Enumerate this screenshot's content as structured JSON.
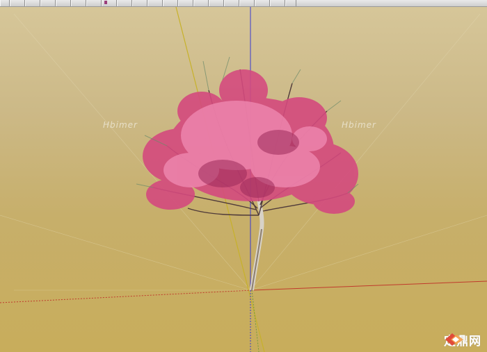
{
  "app": {
    "watermarks": [
      "Hbimer",
      "Hbimer"
    ],
    "brand_logo": {
      "icon": "diamond-logo-icon",
      "text": "定鼎网"
    }
  },
  "toolbar": {
    "icons": [
      "toolbar-icon"
    ],
    "colors": {
      "background": "#dcdcdc",
      "border": "#8f8f8f"
    }
  },
  "viewport": {
    "model": "blossom-tree",
    "axes": {
      "red_axis_color": "#c0392b",
      "green_axis_color": "#6e9a3c",
      "blue_axis_color": "#3a3ad0",
      "guide_color": "#c7b12a"
    },
    "background_colors": [
      "#d6c699",
      "#c8ad5b"
    ]
  }
}
